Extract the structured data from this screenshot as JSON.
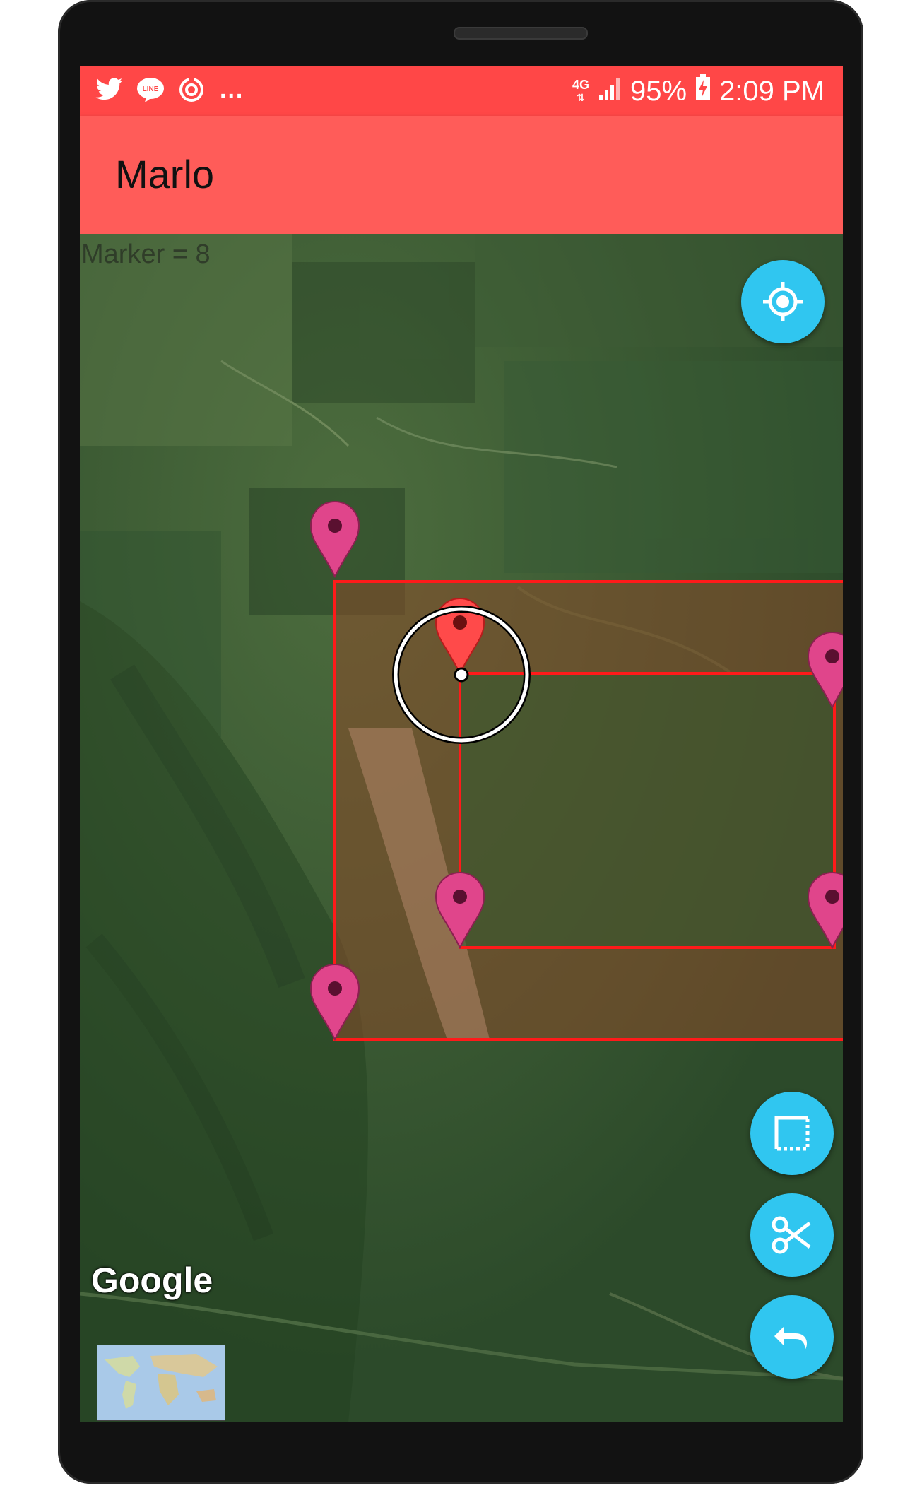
{
  "statusbar": {
    "left_icons": [
      "twitter-icon",
      "line-icon",
      "sync-icon"
    ],
    "ellipsis": "...",
    "network": "4G",
    "battery": "95%",
    "time": "2:09 PM"
  },
  "appbar": {
    "title": "Marlo"
  },
  "map": {
    "overlay_text": "Marker = 8",
    "map_type": "satellite",
    "attribution": "Google",
    "polygon_color": "#ff1a1a",
    "marker_color": "#e0458b",
    "active_marker_color": "#ff4a4a"
  },
  "fabs": {
    "my_location_icon": "my-location-icon",
    "select_area_icon": "select-area-icon",
    "cut_icon": "scissors-icon",
    "undo_icon": "undo-icon"
  },
  "colors": {
    "status_bar": "#ff4747",
    "app_bar": "#ff5c59",
    "fab": "#30c6f0"
  }
}
